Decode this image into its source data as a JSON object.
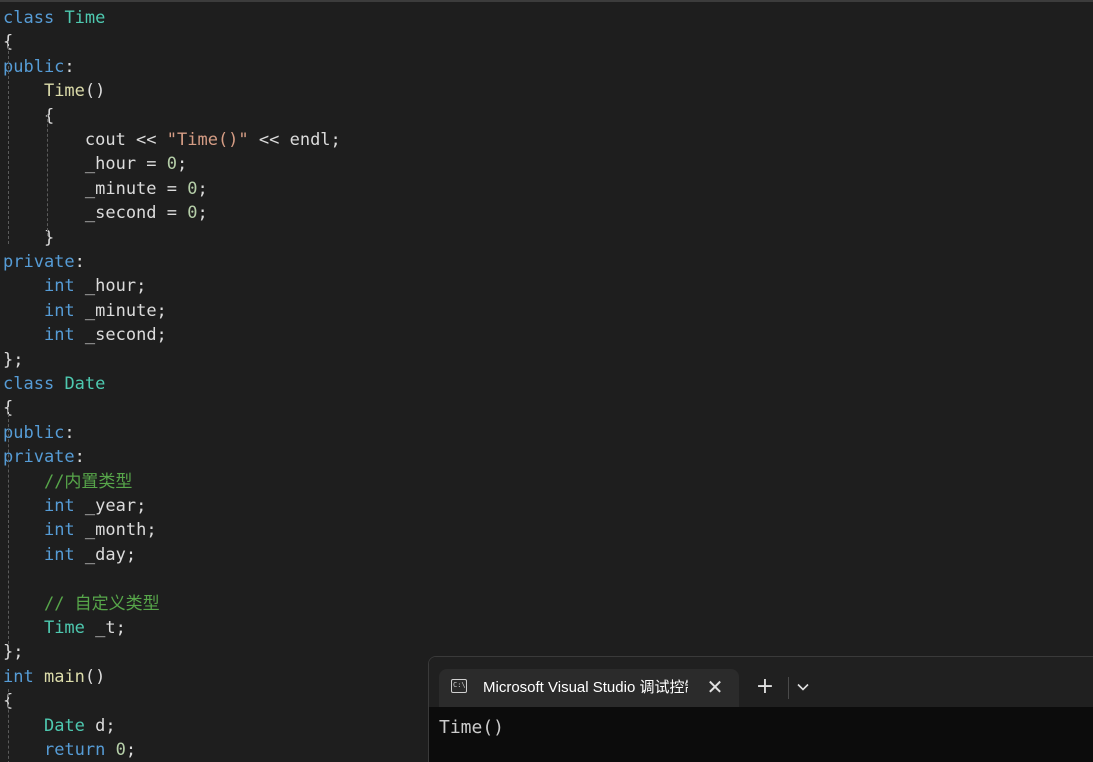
{
  "editor": {
    "lines": [
      [
        [
          "kw",
          "class"
        ],
        [
          "pl",
          " "
        ],
        [
          "ty",
          "Time"
        ]
      ],
      [
        [
          "pl",
          "{"
        ]
      ],
      [
        [
          "kw",
          "public"
        ],
        [
          "pl",
          ":"
        ]
      ],
      [
        [
          "pl",
          "    "
        ],
        [
          "fn",
          "Time"
        ],
        [
          "pl",
          "()"
        ]
      ],
      [
        [
          "pl",
          "    {"
        ]
      ],
      [
        [
          "pl",
          "        cout << "
        ],
        [
          "str",
          "\"Time()\""
        ],
        [
          "pl",
          " << endl;"
        ]
      ],
      [
        [
          "pl",
          "        _hour = "
        ],
        [
          "num",
          "0"
        ],
        [
          "pl",
          ";"
        ]
      ],
      [
        [
          "pl",
          "        _minute = "
        ],
        [
          "num",
          "0"
        ],
        [
          "pl",
          ";"
        ]
      ],
      [
        [
          "pl",
          "        _second = "
        ],
        [
          "num",
          "0"
        ],
        [
          "pl",
          ";"
        ]
      ],
      [
        [
          "pl",
          "    }"
        ]
      ],
      [
        [
          "kw",
          "private"
        ],
        [
          "pl",
          ":"
        ]
      ],
      [
        [
          "pl",
          "    "
        ],
        [
          "kw",
          "int"
        ],
        [
          "pl",
          " _hour;"
        ]
      ],
      [
        [
          "pl",
          "    "
        ],
        [
          "kw",
          "int"
        ],
        [
          "pl",
          " _minute;"
        ]
      ],
      [
        [
          "pl",
          "    "
        ],
        [
          "kw",
          "int"
        ],
        [
          "pl",
          " _second;"
        ]
      ],
      [
        [
          "pl",
          "};"
        ]
      ],
      [
        [
          "kw",
          "class"
        ],
        [
          "pl",
          " "
        ],
        [
          "ty",
          "Date"
        ]
      ],
      [
        [
          "pl",
          "{"
        ]
      ],
      [
        [
          "kw",
          "public"
        ],
        [
          "pl",
          ":"
        ]
      ],
      [
        [
          "kw",
          "private"
        ],
        [
          "pl",
          ":"
        ]
      ],
      [
        [
          "pl",
          "    "
        ],
        [
          "cm",
          "//内置类型"
        ]
      ],
      [
        [
          "pl",
          "    "
        ],
        [
          "kw",
          "int"
        ],
        [
          "pl",
          " _year;"
        ]
      ],
      [
        [
          "pl",
          "    "
        ],
        [
          "kw",
          "int"
        ],
        [
          "pl",
          " _month;"
        ]
      ],
      [
        [
          "pl",
          "    "
        ],
        [
          "kw",
          "int"
        ],
        [
          "pl",
          " _day;"
        ]
      ],
      [
        [
          "pl",
          ""
        ]
      ],
      [
        [
          "pl",
          "    "
        ],
        [
          "cm",
          "// 自定义类型"
        ]
      ],
      [
        [
          "pl",
          "    "
        ],
        [
          "ty",
          "Time"
        ],
        [
          "pl",
          " _t;"
        ]
      ],
      [
        [
          "pl",
          "};"
        ]
      ],
      [
        [
          "kw",
          "int"
        ],
        [
          "pl",
          " "
        ],
        [
          "fn",
          "main"
        ],
        [
          "pl",
          "()"
        ]
      ],
      [
        [
          "pl",
          "{"
        ]
      ],
      [
        [
          "pl",
          "    "
        ],
        [
          "ty",
          "Date"
        ],
        [
          "pl",
          " d;"
        ]
      ],
      [
        [
          "pl",
          "    "
        ],
        [
          "kw",
          "return"
        ],
        [
          "pl",
          " "
        ],
        [
          "num",
          "0"
        ],
        [
          "pl",
          ";"
        ]
      ]
    ]
  },
  "console": {
    "tab_title": "Microsoft Visual Studio 调试控制台",
    "tab_icon_glyph": "C:\\",
    "close_glyph": "✕",
    "new_tab_glyph": "+",
    "dropdown_icon": "chevron-down-icon",
    "output": "Time()"
  },
  "colors": {
    "editor_bg": "#1e1e1e",
    "keyword": "#569cd6",
    "type": "#4ec9b0",
    "function": "#dcdcaa",
    "string": "#d69d85",
    "number": "#b5cea8",
    "comment": "#57a64a",
    "console_bg": "#0c0c0c"
  }
}
